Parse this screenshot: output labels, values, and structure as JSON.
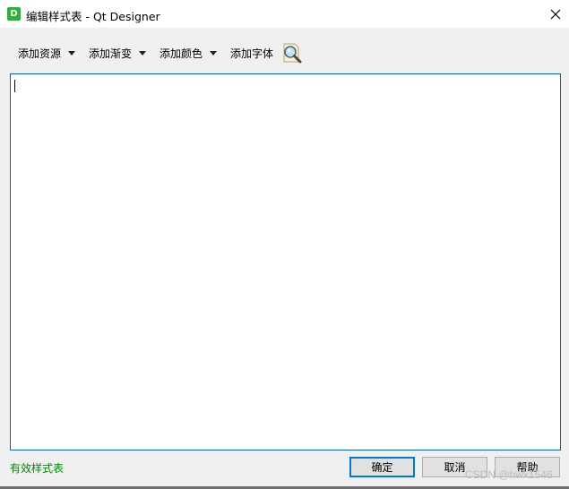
{
  "window": {
    "app_icon_letter": "D",
    "title": "编辑样式表 - Qt Designer",
    "close_glyph": "✕"
  },
  "toolbar": {
    "items": [
      {
        "label": "添加资源",
        "has_dropdown": true
      },
      {
        "label": "添加渐变",
        "has_dropdown": true
      },
      {
        "label": "添加颜色",
        "has_dropdown": true
      },
      {
        "label": "添加字体",
        "has_dropdown": false
      }
    ],
    "find_icon": "magnifier-icon"
  },
  "editor": {
    "content": ""
  },
  "status": {
    "text": "有效样式表",
    "color": "#008a00"
  },
  "buttons": {
    "ok": "确定",
    "cancel": "取消",
    "help": "帮助"
  },
  "watermark": "CSDN @hwx1546",
  "colors": {
    "accent": "#0078d7",
    "editor_border": "#0a64b4"
  }
}
